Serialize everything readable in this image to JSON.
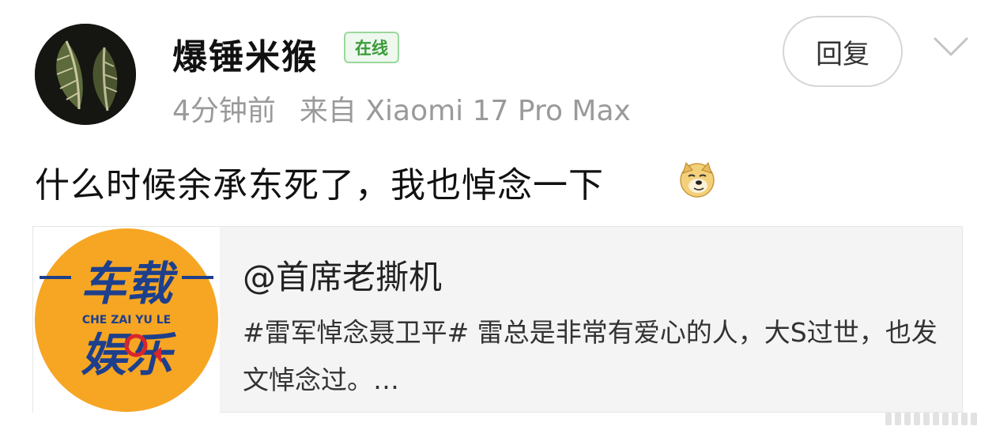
{
  "post": {
    "author": {
      "name": "爆锤米猴",
      "status_badge": "在线"
    },
    "time": "4分钟前",
    "source": "来自 Xiaomi 17 Pro Max",
    "reply_label": "回复",
    "text": "什么时候余承东死了，我也悼念一下"
  },
  "linked_card": {
    "title": "@首席老撕机",
    "description": "#雷军悼念聂卫平# 雷总是非常有爱心的人，大S过世，也发文悼念过。…",
    "logo": {
      "line1": "车载",
      "line2": "CHE ZAI YU LE",
      "line3": "娱乐",
      "colors": {
        "background": "#f6a623",
        "text": "#1d3f8c",
        "accent": "#d9262b"
      }
    }
  },
  "icons": {
    "emoji": "doge-emoji-icon",
    "dropdown": "chevron-down-icon"
  },
  "colors": {
    "badge_border": "#9bd89b",
    "badge_text": "#3a9b3a",
    "meta_text": "#9a9a9a",
    "card_bg": "#f4f4f4"
  }
}
